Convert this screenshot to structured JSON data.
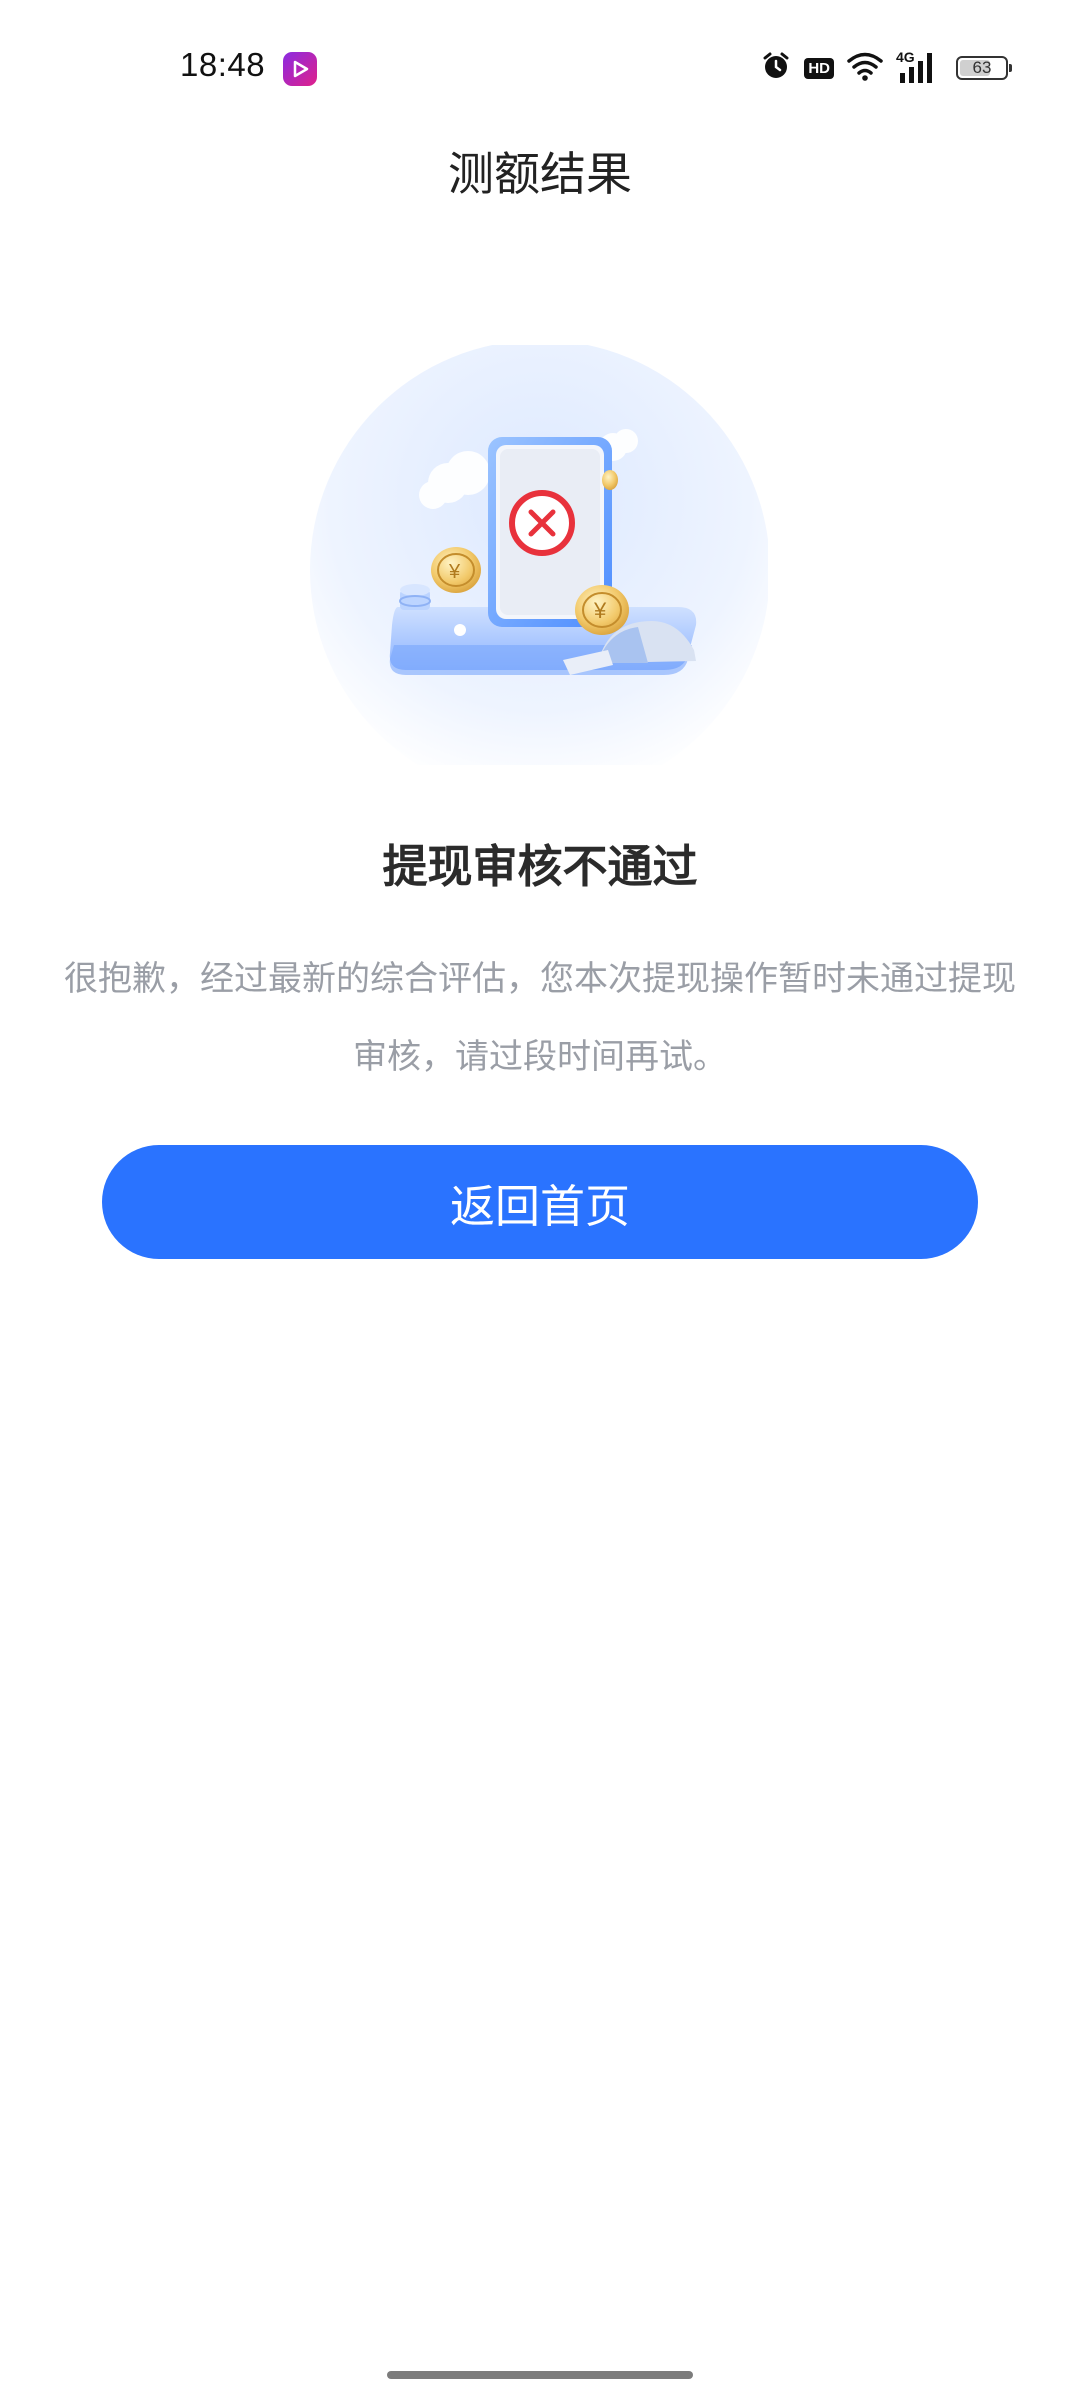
{
  "status_bar": {
    "time": "18:48",
    "hd_label": "HD",
    "network_label": "4G",
    "battery_level": "63",
    "battery_fraction": 0.63,
    "icons": [
      "video-app-icon",
      "alarm-icon",
      "hd-icon",
      "wifi-icon",
      "signal-icon",
      "battery-icon"
    ]
  },
  "header": {
    "title": "测额结果"
  },
  "illustration": {
    "icon": "rejected-withdrawal-illustration",
    "accent_color": "#2a73ff",
    "error_color": "#e8323c"
  },
  "result": {
    "title": "提现审核不通过",
    "description": "很抱歉，经过最新的综合评估，您本次提现操作暂时未通过提现审核，请过段时间再试。"
  },
  "actions": {
    "home_button_label": "返回首页",
    "home_button_color": "#2a73ff"
  }
}
